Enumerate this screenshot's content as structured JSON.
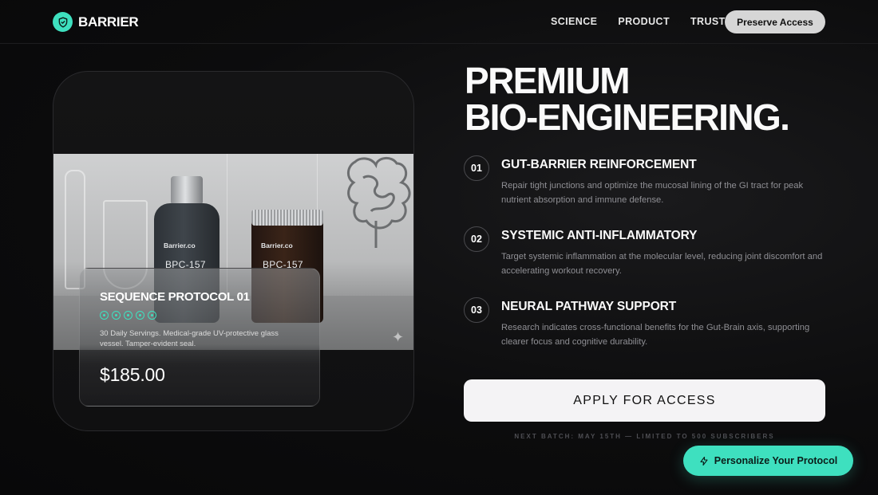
{
  "nav": {
    "brand": "BARRIER",
    "links": [
      "SCIENCE",
      "PRODUCT",
      "TRUST"
    ],
    "cta": "Preserve Access"
  },
  "product": {
    "bottle_brand": "Barrier.co",
    "bottle_label": "BPC-157",
    "jar_brand": "Barrier.co",
    "jar_label": "BPC-157",
    "title": "SEQUENCE PROTOCOL 01",
    "rating": 5,
    "description": "30 Daily Servings. Medical-grade UV-protective glass vessel. Tamper-evident seal.",
    "price": "$185.00"
  },
  "hero": {
    "headline_line1": "PREMIUM",
    "headline_line2": "BIO-ENGINEERING."
  },
  "features": [
    {
      "num": "01",
      "title": "GUT-BARRIER REINFORCEMENT",
      "desc": "Repair tight junctions and optimize the mucosal lining of the GI tract for peak nutrient absorption and immune defense."
    },
    {
      "num": "02",
      "title": "SYSTEMIC ANTI-INFLAMMATORY",
      "desc": "Target systemic inflammation at the molecular level, reducing joint discomfort and accelerating workout recovery."
    },
    {
      "num": "03",
      "title": "NEURAL PATHWAY SUPPORT",
      "desc": "Research indicates cross-functional benefits for the Gut-Brain axis, supporting clearer focus and cognitive durability."
    }
  ],
  "apply": {
    "label": "APPLY FOR ACCESS",
    "note": "NEXT BATCH: MAY 15TH — LIMITED TO 500 SUBSCRIBERS"
  },
  "fab": {
    "label": "Personalize Your Protocol"
  },
  "colors": {
    "accent": "#3ee0bf",
    "background": "#0b0b0c"
  }
}
